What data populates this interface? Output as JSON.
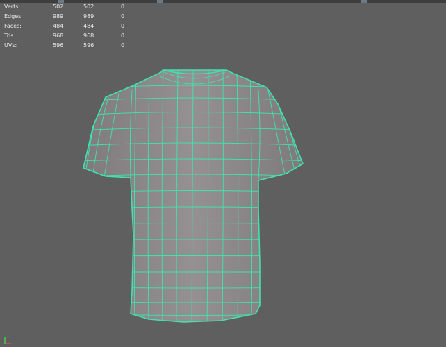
{
  "hud": {
    "rows": [
      {
        "label": "Verts:",
        "v1": "502",
        "v2": "502",
        "v3": "0"
      },
      {
        "label": "Edges:",
        "v1": "989",
        "v2": "989",
        "v3": "0"
      },
      {
        "label": "Faces:",
        "v1": "484",
        "v2": "484",
        "v3": "0"
      },
      {
        "label": "Tris:",
        "v1": "968",
        "v2": "968",
        "v3": "0"
      },
      {
        "label": "UVs:",
        "v1": "596",
        "v2": "596",
        "v3": "0"
      }
    ]
  },
  "colors": {
    "viewport_bg": "#5f5f5f",
    "mesh_fill": "#8e8a8b",
    "wire": "#3fe3b0"
  },
  "icons": [
    "tshirt-mesh",
    "axis-gizmo-icon"
  ]
}
